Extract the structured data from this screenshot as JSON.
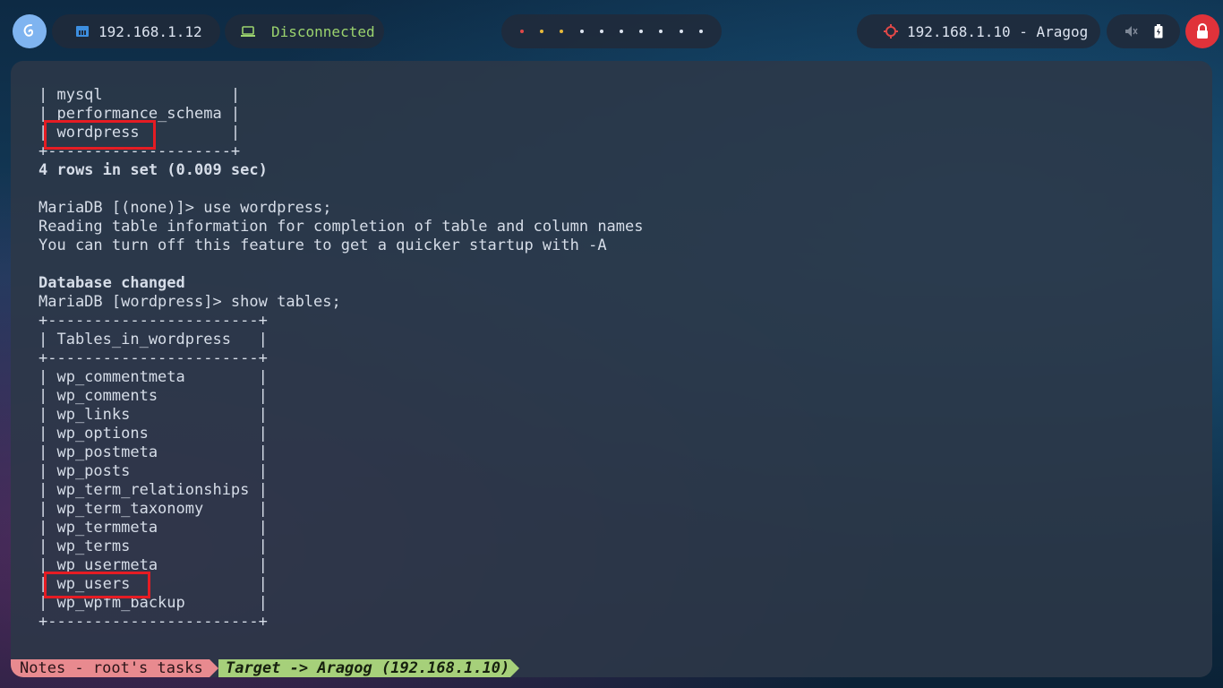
{
  "topbar": {
    "host_ip": "192.168.1.12",
    "vpn_status": "Disconnected",
    "target": "192.168.1.10 - Aragog",
    "workspace_dot_colors": [
      "#e04848",
      "#e8b93a",
      "#e8b93a",
      "#dce3ef",
      "#dce3ef",
      "#dce3ef",
      "#dce3ef",
      "#dce3ef",
      "#dce3ef",
      "#dce3ef"
    ],
    "icons": {
      "logo": "debian-swirl-icon",
      "host": "ethernet-icon",
      "vpn": "laptop-icon",
      "target": "crosshair-target-icon",
      "volume": "mute-icon",
      "battery": "battery-icon",
      "power": "lock-icon"
    }
  },
  "terminal": {
    "lines": [
      "| mysql              |",
      "| performance_schema |",
      "| wordpress          |",
      "+--------------------+",
      "4 rows in set (0.009 sec)",
      "",
      "MariaDB [(none)]> use wordpress;",
      "Reading table information for completion of table and column names",
      "You can turn off this feature to get a quicker startup with -A",
      "",
      "Database changed",
      "MariaDB [wordpress]> show tables;",
      "+-----------------------+",
      "| Tables_in_wordpress   |",
      "+-----------------------+",
      "| wp_commentmeta        |",
      "| wp_comments           |",
      "| wp_links              |",
      "| wp_options            |",
      "| wp_postmeta           |",
      "| wp_posts              |",
      "| wp_term_relationships |",
      "| wp_term_taxonomy      |",
      "| wp_termmeta           |",
      "| wp_terms              |",
      "| wp_usermeta           |",
      "| wp_users              |",
      "| wp_wpfm_backup        |",
      "+-----------------------+"
    ],
    "highlighted": [
      "wordpress",
      "wp_users"
    ]
  },
  "statusline": {
    "left": "Notes - root's tasks",
    "right": "Target -> Aragog (192.168.1.10)"
  },
  "colors": {
    "highlight_box": "#e51c23",
    "notes_segment": "#e88a8f",
    "target_segment": "#a6d07a",
    "vpn_text": "#9bd36e",
    "power_button": "#e0323a"
  }
}
